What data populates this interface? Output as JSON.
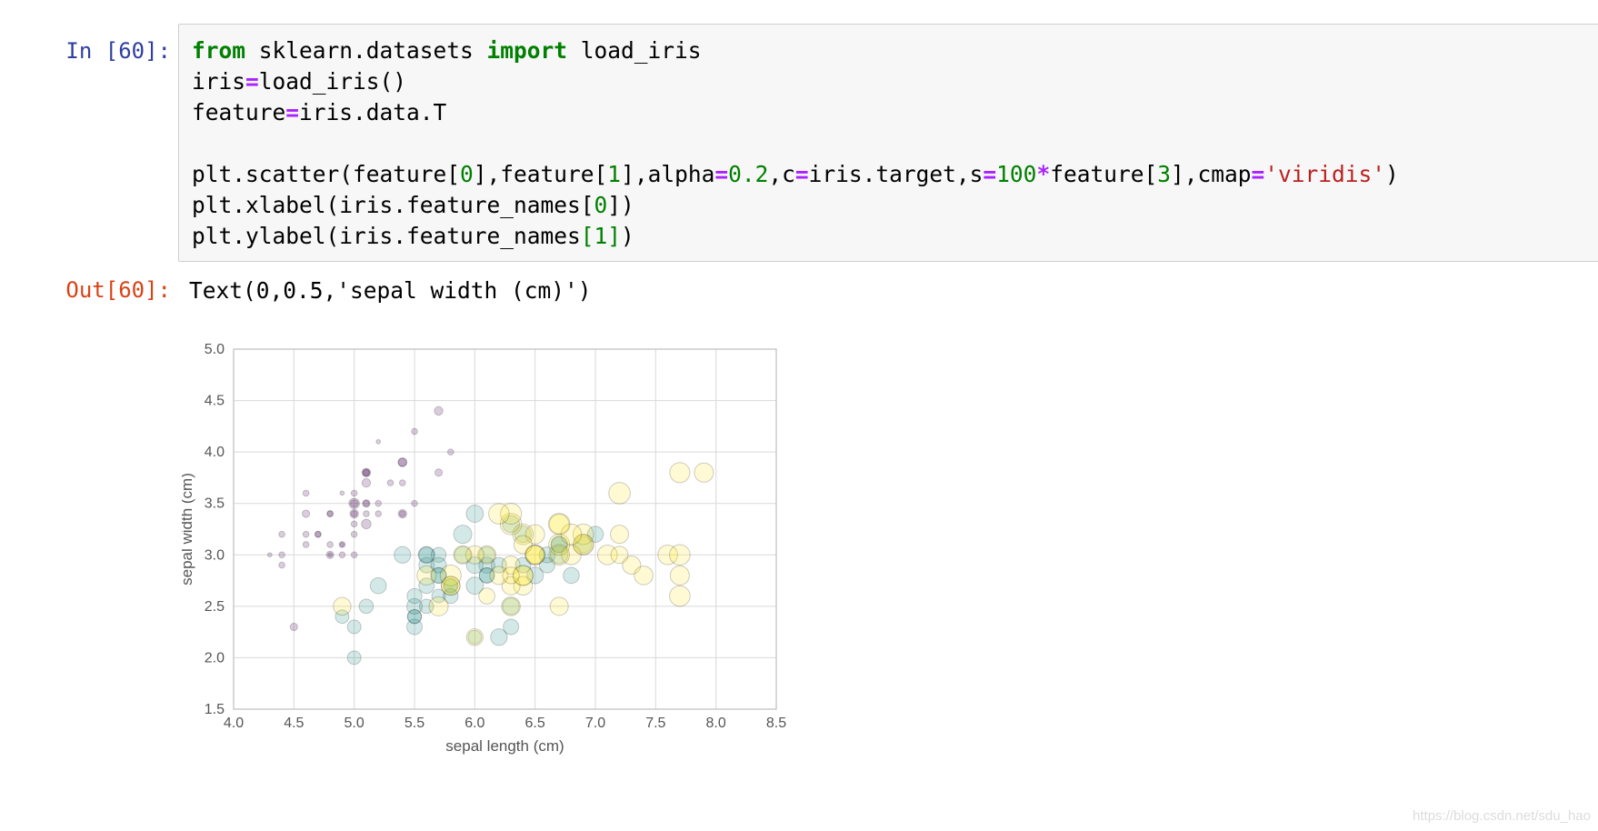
{
  "notebook": {
    "in_prompt": "In [60]:",
    "out_prompt": "Out[60]:",
    "output_text": "Text(0,0.5,'sepal width (cm)')",
    "watermark": "https://blog.csdn.net/sdu_hao"
  },
  "code": {
    "line1": [
      {
        "t": "from",
        "c": "kw"
      },
      {
        "t": " sklearn.datasets ",
        "c": ""
      },
      {
        "t": "import",
        "c": "kw"
      },
      {
        "t": " load_iris",
        "c": ""
      }
    ],
    "line2": [
      {
        "t": "iris",
        "c": ""
      },
      {
        "t": "=",
        "c": "op"
      },
      {
        "t": "load_iris()",
        "c": ""
      }
    ],
    "line3": [
      {
        "t": "feature",
        "c": ""
      },
      {
        "t": "=",
        "c": "op"
      },
      {
        "t": "iris.data.T",
        "c": ""
      }
    ],
    "line4": [],
    "line5": [
      {
        "t": "plt.scatter(feature[",
        "c": ""
      },
      {
        "t": "0",
        "c": "num"
      },
      {
        "t": "],feature[",
        "c": ""
      },
      {
        "t": "1",
        "c": "num"
      },
      {
        "t": "],alpha",
        "c": ""
      },
      {
        "t": "=",
        "c": "op"
      },
      {
        "t": "0.2",
        "c": "num"
      },
      {
        "t": ",c",
        "c": ""
      },
      {
        "t": "=",
        "c": "op"
      },
      {
        "t": "iris.target,s",
        "c": ""
      },
      {
        "t": "=",
        "c": "op"
      },
      {
        "t": "100",
        "c": "num"
      },
      {
        "t": "*",
        "c": "op"
      },
      {
        "t": "feature[",
        "c": ""
      },
      {
        "t": "3",
        "c": "num"
      },
      {
        "t": "],cmap",
        "c": ""
      },
      {
        "t": "=",
        "c": "op"
      },
      {
        "t": "'viridis'",
        "c": "str"
      },
      {
        "t": ")",
        "c": ""
      }
    ],
    "line6": [
      {
        "t": "plt.xlabel(iris.feature_names[",
        "c": ""
      },
      {
        "t": "0",
        "c": "num"
      },
      {
        "t": "])",
        "c": ""
      }
    ],
    "line7": [
      {
        "t": "plt.ylabel(iris.feature_names",
        "c": ""
      },
      {
        "t": "[1]",
        "c": "num"
      },
      {
        "t": ")",
        "c": ""
      }
    ]
  },
  "chart_data": {
    "type": "scatter",
    "xlabel": "sepal length (cm)",
    "ylabel": "sepal width (cm)",
    "xlim": [
      4.0,
      8.5
    ],
    "ylim": [
      1.5,
      5.0
    ],
    "xticks": [
      "4.0",
      "4.5",
      "5.0",
      "5.5",
      "6.0",
      "6.5",
      "7.0",
      "7.5",
      "8.0",
      "8.5"
    ],
    "yticks": [
      "1.5",
      "2.0",
      "2.5",
      "3.0",
      "3.5",
      "4.0",
      "4.5",
      "5.0"
    ],
    "grid": true,
    "alpha": 0.2,
    "colormap": "viridis",
    "class_colors": [
      "#440154",
      "#21918c",
      "#fde725"
    ],
    "points": [
      [
        5.1,
        3.5,
        0.2,
        0
      ],
      [
        4.9,
        3.0,
        0.2,
        0
      ],
      [
        4.7,
        3.2,
        0.2,
        0
      ],
      [
        4.6,
        3.1,
        0.2,
        0
      ],
      [
        5.0,
        3.6,
        0.2,
        0
      ],
      [
        5.4,
        3.9,
        0.4,
        0
      ],
      [
        4.6,
        3.4,
        0.3,
        0
      ],
      [
        5.0,
        3.4,
        0.2,
        0
      ],
      [
        4.4,
        2.9,
        0.2,
        0
      ],
      [
        4.9,
        3.1,
        0.1,
        0
      ],
      [
        5.4,
        3.7,
        0.2,
        0
      ],
      [
        4.8,
        3.4,
        0.2,
        0
      ],
      [
        4.8,
        3.0,
        0.1,
        0
      ],
      [
        4.3,
        3.0,
        0.1,
        0
      ],
      [
        5.8,
        4.0,
        0.2,
        0
      ],
      [
        5.7,
        4.4,
        0.4,
        0
      ],
      [
        5.4,
        3.9,
        0.4,
        0
      ],
      [
        5.1,
        3.5,
        0.3,
        0
      ],
      [
        5.7,
        3.8,
        0.3,
        0
      ],
      [
        5.1,
        3.8,
        0.3,
        0
      ],
      [
        5.4,
        3.4,
        0.2,
        0
      ],
      [
        5.1,
        3.7,
        0.4,
        0
      ],
      [
        4.6,
        3.6,
        0.2,
        0
      ],
      [
        5.1,
        3.3,
        0.5,
        0
      ],
      [
        4.8,
        3.4,
        0.2,
        0
      ],
      [
        5.0,
        3.0,
        0.2,
        0
      ],
      [
        5.0,
        3.4,
        0.4,
        0
      ],
      [
        5.2,
        3.5,
        0.2,
        0
      ],
      [
        5.2,
        3.4,
        0.2,
        0
      ],
      [
        4.7,
        3.2,
        0.2,
        0
      ],
      [
        4.8,
        3.1,
        0.2,
        0
      ],
      [
        5.4,
        3.4,
        0.4,
        0
      ],
      [
        5.2,
        4.1,
        0.1,
        0
      ],
      [
        5.5,
        4.2,
        0.2,
        0
      ],
      [
        4.9,
        3.1,
        0.2,
        0
      ],
      [
        5.0,
        3.2,
        0.2,
        0
      ],
      [
        5.5,
        3.5,
        0.2,
        0
      ],
      [
        4.9,
        3.6,
        0.1,
        0
      ],
      [
        4.4,
        3.0,
        0.2,
        0
      ],
      [
        5.1,
        3.4,
        0.2,
        0
      ],
      [
        5.0,
        3.5,
        0.3,
        0
      ],
      [
        4.5,
        2.3,
        0.3,
        0
      ],
      [
        4.4,
        3.2,
        0.2,
        0
      ],
      [
        5.0,
        3.5,
        0.6,
        0
      ],
      [
        5.1,
        3.8,
        0.4,
        0
      ],
      [
        4.8,
        3.0,
        0.3,
        0
      ],
      [
        5.1,
        3.8,
        0.2,
        0
      ],
      [
        4.6,
        3.2,
        0.2,
        0
      ],
      [
        5.3,
        3.7,
        0.2,
        0
      ],
      [
        5.0,
        3.3,
        0.2,
        0
      ],
      [
        7.0,
        3.2,
        1.4,
        1
      ],
      [
        6.4,
        3.2,
        1.5,
        1
      ],
      [
        6.9,
        3.1,
        1.5,
        1
      ],
      [
        5.5,
        2.3,
        1.3,
        1
      ],
      [
        6.5,
        2.8,
        1.5,
        1
      ],
      [
        5.7,
        2.8,
        1.3,
        1
      ],
      [
        6.3,
        3.3,
        1.6,
        1
      ],
      [
        4.9,
        2.4,
        1.0,
        1
      ],
      [
        6.6,
        2.9,
        1.3,
        1
      ],
      [
        5.2,
        2.7,
        1.4,
        1
      ],
      [
        5.0,
        2.0,
        1.0,
        1
      ],
      [
        5.9,
        3.0,
        1.5,
        1
      ],
      [
        6.0,
        2.2,
        1.0,
        1
      ],
      [
        6.1,
        2.9,
        1.4,
        1
      ],
      [
        5.6,
        2.9,
        1.3,
        1
      ],
      [
        6.7,
        3.1,
        1.4,
        1
      ],
      [
        5.6,
        3.0,
        1.5,
        1
      ],
      [
        5.8,
        2.7,
        1.0,
        1
      ],
      [
        6.2,
        2.2,
        1.5,
        1
      ],
      [
        5.6,
        2.5,
        1.1,
        1
      ],
      [
        5.9,
        3.2,
        1.8,
        1
      ],
      [
        6.1,
        2.8,
        1.3,
        1
      ],
      [
        6.3,
        2.5,
        1.5,
        1
      ],
      [
        6.1,
        2.8,
        1.2,
        1
      ],
      [
        6.4,
        2.9,
        1.3,
        1
      ],
      [
        6.6,
        3.0,
        1.4,
        1
      ],
      [
        6.8,
        2.8,
        1.4,
        1
      ],
      [
        6.7,
        3.0,
        1.7,
        1
      ],
      [
        6.0,
        2.9,
        1.5,
        1
      ],
      [
        5.7,
        2.6,
        1.0,
        1
      ],
      [
        5.5,
        2.4,
        1.1,
        1
      ],
      [
        5.5,
        2.4,
        1.0,
        1
      ],
      [
        5.8,
        2.7,
        1.2,
        1
      ],
      [
        6.0,
        2.7,
        1.6,
        1
      ],
      [
        5.4,
        3.0,
        1.5,
        1
      ],
      [
        6.0,
        3.4,
        1.6,
        1
      ],
      [
        6.7,
        3.1,
        1.5,
        1
      ],
      [
        6.3,
        2.3,
        1.3,
        1
      ],
      [
        5.6,
        3.0,
        1.3,
        1
      ],
      [
        5.5,
        2.5,
        1.3,
        1
      ],
      [
        5.5,
        2.6,
        1.2,
        1
      ],
      [
        6.1,
        3.0,
        1.4,
        1
      ],
      [
        5.8,
        2.6,
        1.2,
        1
      ],
      [
        5.0,
        2.3,
        1.0,
        1
      ],
      [
        5.6,
        2.7,
        1.3,
        1
      ],
      [
        5.7,
        3.0,
        1.2,
        1
      ],
      [
        5.7,
        2.9,
        1.3,
        1
      ],
      [
        6.2,
        2.9,
        1.3,
        1
      ],
      [
        5.1,
        2.5,
        1.1,
        1
      ],
      [
        5.7,
        2.8,
        1.3,
        1
      ],
      [
        6.3,
        3.3,
        2.5,
        2
      ],
      [
        5.8,
        2.7,
        1.9,
        2
      ],
      [
        7.1,
        3.0,
        2.1,
        2
      ],
      [
        6.3,
        2.9,
        1.8,
        2
      ],
      [
        6.5,
        3.0,
        2.2,
        2
      ],
      [
        7.6,
        3.0,
        2.1,
        2
      ],
      [
        4.9,
        2.5,
        1.7,
        2
      ],
      [
        7.3,
        2.9,
        1.8,
        2
      ],
      [
        6.7,
        2.5,
        1.8,
        2
      ],
      [
        7.2,
        3.6,
        2.5,
        2
      ],
      [
        6.5,
        3.2,
        2.0,
        2
      ],
      [
        6.4,
        2.7,
        1.9,
        2
      ],
      [
        6.8,
        3.0,
        2.1,
        2
      ],
      [
        5.7,
        2.5,
        2.0,
        2
      ],
      [
        5.8,
        2.8,
        2.4,
        2
      ],
      [
        6.4,
        3.2,
        2.3,
        2
      ],
      [
        6.5,
        3.0,
        1.8,
        2
      ],
      [
        7.7,
        3.8,
        2.2,
        2
      ],
      [
        7.7,
        2.6,
        2.3,
        2
      ],
      [
        6.0,
        2.2,
        1.5,
        2
      ],
      [
        6.9,
        3.2,
        2.3,
        2
      ],
      [
        5.6,
        2.8,
        2.0,
        2
      ],
      [
        7.7,
        2.8,
        2.0,
        2
      ],
      [
        6.3,
        2.7,
        1.8,
        2
      ],
      [
        6.7,
        3.3,
        2.1,
        2
      ],
      [
        7.2,
        3.2,
        1.8,
        2
      ],
      [
        6.2,
        2.8,
        1.8,
        2
      ],
      [
        6.1,
        3.0,
        1.8,
        2
      ],
      [
        6.4,
        2.8,
        2.1,
        2
      ],
      [
        7.2,
        3.0,
        1.6,
        2
      ],
      [
        7.4,
        2.8,
        1.9,
        2
      ],
      [
        7.9,
        3.8,
        2.0,
        2
      ],
      [
        6.4,
        2.8,
        2.2,
        2
      ],
      [
        6.3,
        2.8,
        1.5,
        2
      ],
      [
        6.1,
        2.6,
        1.4,
        2
      ],
      [
        7.7,
        3.0,
        2.3,
        2
      ],
      [
        6.3,
        3.4,
        2.4,
        2
      ],
      [
        6.4,
        3.1,
        1.8,
        2
      ],
      [
        6.0,
        3.0,
        1.8,
        2
      ],
      [
        6.9,
        3.1,
        2.1,
        2
      ],
      [
        6.7,
        3.1,
        2.4,
        2
      ],
      [
        6.9,
        3.1,
        2.3,
        2
      ],
      [
        5.8,
        2.7,
        1.9,
        2
      ],
      [
        6.8,
        3.2,
        2.3,
        2
      ],
      [
        6.7,
        3.3,
        2.5,
        2
      ],
      [
        6.7,
        3.0,
        2.3,
        2
      ],
      [
        6.3,
        2.5,
        1.9,
        2
      ],
      [
        6.5,
        3.0,
        2.0,
        2
      ],
      [
        6.2,
        3.4,
        2.3,
        2
      ],
      [
        5.9,
        3.0,
        1.8,
        2
      ]
    ]
  }
}
